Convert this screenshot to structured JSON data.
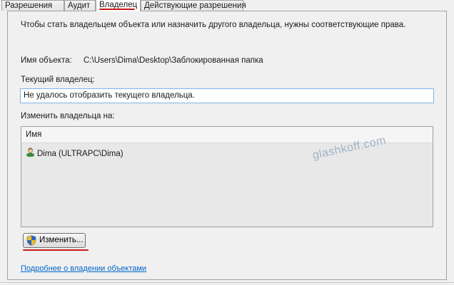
{
  "tabs": [
    {
      "label": "Разрешения",
      "active": false
    },
    {
      "label": "Аудит",
      "active": false
    },
    {
      "label": "Владелец",
      "active": true
    },
    {
      "label": "Действующие разрешения",
      "active": false
    }
  ],
  "owner": {
    "intro_text": "Чтобы стать владельцем объекта или назначить другого владельца, нужны соответствующие права.",
    "object_name_label": "Имя объекта:",
    "object_name_value": "C:\\Users\\Dima\\Desktop\\Заблокированная папка",
    "current_owner_label": "Текущий владелец:",
    "current_owner_value": "Не удалось отобразить текущего владельца.",
    "change_owner_label": "Изменить владельца на:",
    "list_header": "Имя",
    "list_items": [
      {
        "name": "Dima (ULTRAPC\\Dima)",
        "icon": "user-icon"
      }
    ],
    "change_button_label": "Изменить...",
    "change_button_icon": "uac-shield-icon",
    "help_link": "Подробнее о владении объектами"
  },
  "watermark": "glashkoff.com",
  "colors": {
    "highlight_underline": "#cc1a1a",
    "link": "#0066cc",
    "field_focus_border": "#7eb4ea"
  }
}
